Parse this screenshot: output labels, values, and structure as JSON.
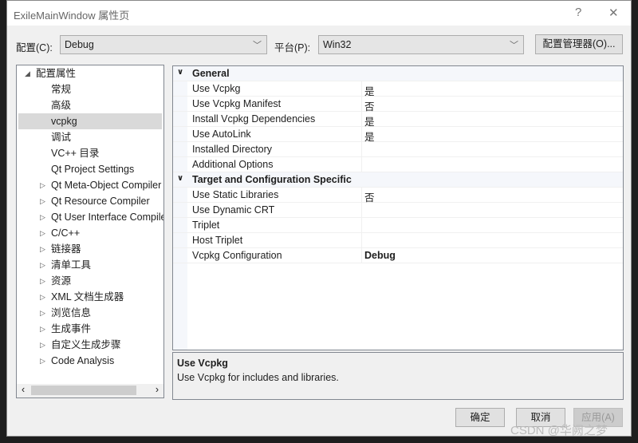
{
  "title": "ExileMainWindow 属性页",
  "help": "?",
  "close": "✕",
  "config": {
    "label": "配置(C):",
    "value": "Debug"
  },
  "platform": {
    "label": "平台(P):",
    "value": "Win32"
  },
  "config_manager": "配置管理器(O)...",
  "tree": [
    {
      "label": "配置属性",
      "level": 0,
      "expander": "expanded"
    },
    {
      "label": "常规",
      "level": 1
    },
    {
      "label": "高级",
      "level": 1
    },
    {
      "label": "vcpkg",
      "level": 1,
      "selected": true
    },
    {
      "label": "调试",
      "level": 1
    },
    {
      "label": "VC++ 目录",
      "level": 1
    },
    {
      "label": "Qt Project Settings",
      "level": 1
    },
    {
      "label": "Qt Meta-Object Compiler",
      "level": 1,
      "expander": "collapsed"
    },
    {
      "label": "Qt Resource Compiler",
      "level": 1,
      "expander": "collapsed"
    },
    {
      "label": "Qt User Interface Compiler",
      "level": 1,
      "expander": "collapsed"
    },
    {
      "label": "C/C++",
      "level": 1,
      "expander": "collapsed"
    },
    {
      "label": "链接器",
      "level": 1,
      "expander": "collapsed"
    },
    {
      "label": "清单工具",
      "level": 1,
      "expander": "collapsed"
    },
    {
      "label": "资源",
      "level": 1,
      "expander": "collapsed"
    },
    {
      "label": "XML 文档生成器",
      "level": 1,
      "expander": "collapsed"
    },
    {
      "label": "浏览信息",
      "level": 1,
      "expander": "collapsed"
    },
    {
      "label": "生成事件",
      "level": 1,
      "expander": "collapsed"
    },
    {
      "label": "自定义生成步骤",
      "level": 1,
      "expander": "collapsed"
    },
    {
      "label": "Code Analysis",
      "level": 1,
      "expander": "collapsed"
    }
  ],
  "grid": [
    {
      "category": "General"
    },
    {
      "name": "Use Vcpkg",
      "value": "是"
    },
    {
      "name": "Use Vcpkg Manifest",
      "value": "否"
    },
    {
      "name": "Install Vcpkg Dependencies",
      "value": "是"
    },
    {
      "name": "Use AutoLink",
      "value": "是"
    },
    {
      "name": "Installed Directory",
      "value": ""
    },
    {
      "name": "Additional Options",
      "value": ""
    },
    {
      "category": "Target and Configuration Specific"
    },
    {
      "name": "Use Static Libraries",
      "value": "否"
    },
    {
      "name": "Use Dynamic CRT",
      "value": ""
    },
    {
      "name": "Triplet",
      "value": ""
    },
    {
      "name": "Host Triplet",
      "value": ""
    },
    {
      "name": "Vcpkg Configuration",
      "value": "Debug",
      "bold": true
    }
  ],
  "description": {
    "title": "Use Vcpkg",
    "text": "Use Vcpkg for includes and libraries."
  },
  "buttons": {
    "ok": "确定",
    "cancel": "取消",
    "apply": "应用(A)"
  },
  "watermark": "CSDN @华阙之梦"
}
